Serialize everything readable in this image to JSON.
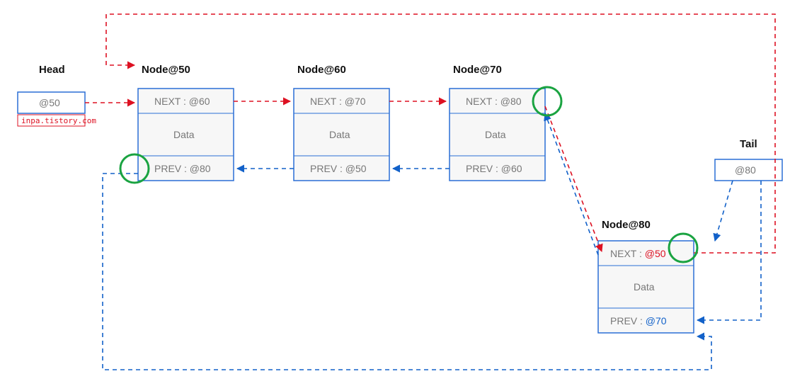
{
  "head": {
    "label": "Head",
    "value": "@50"
  },
  "tail": {
    "label": "Tail",
    "value": "@80"
  },
  "watermark": "inpa.tistory.com",
  "nodes": [
    {
      "title": "Node@50",
      "next": "NEXT : @60",
      "data": "Data",
      "prev": "PREV : @80"
    },
    {
      "title": "Node@60",
      "next": "NEXT : @70",
      "data": "Data",
      "prev": "PREV : @50"
    },
    {
      "title": "Node@70",
      "next": "NEXT : @80",
      "data": "Data",
      "prev": "PREV : @60"
    },
    {
      "title": "Node@80",
      "next_label": "NEXT : ",
      "next_val": "@50",
      "data": "Data",
      "prev_label": "PREV : ",
      "prev_val": "@70"
    }
  ]
}
